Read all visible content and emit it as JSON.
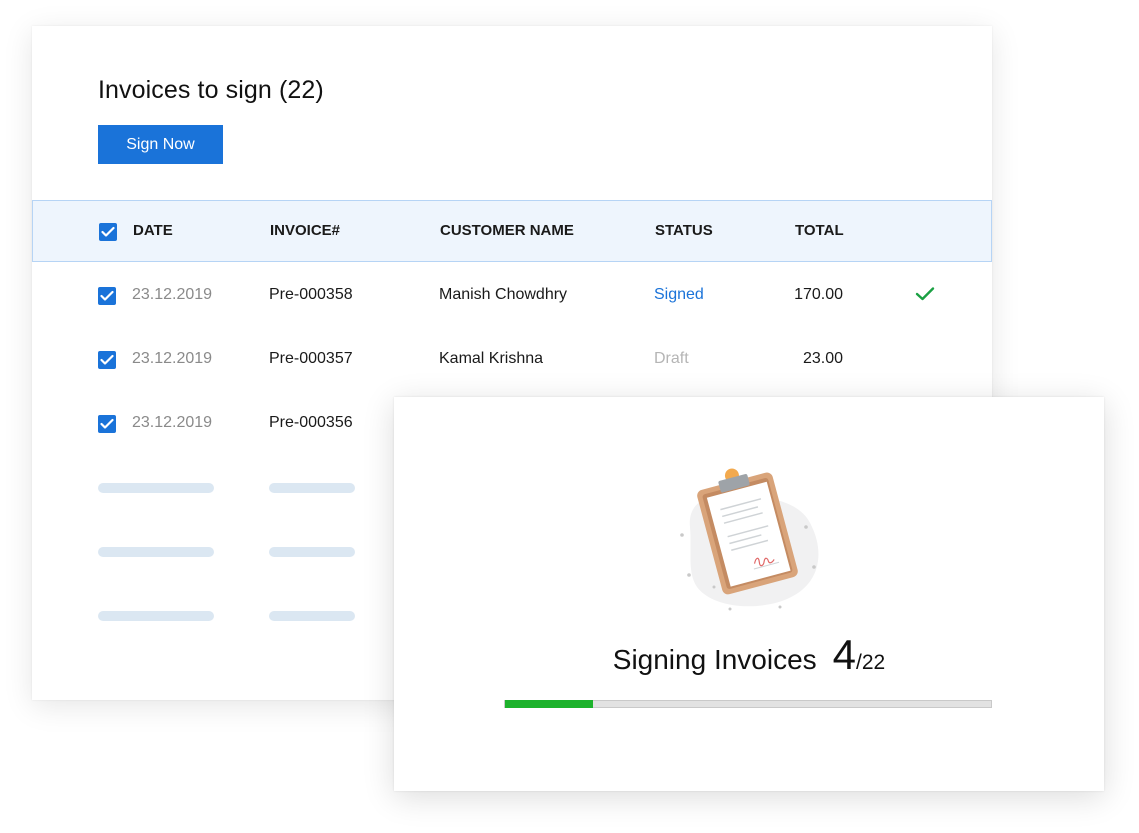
{
  "invoices": {
    "title": "Invoices to sign (22)",
    "sign_button_label": "Sign Now",
    "columns": {
      "date": "DATE",
      "invoice": "INVOICE#",
      "customer": "CUSTOMER NAME",
      "status": "STATUS",
      "total": "TOTAL"
    },
    "rows": [
      {
        "date": "23.12.2019",
        "invoice": "Pre-000358",
        "customer": "Manish Chowdhry",
        "status": "Signed",
        "total": "170.00",
        "checked": true,
        "signed": true
      },
      {
        "date": "23.12.2019",
        "invoice": "Pre-000357",
        "customer": "Kamal Krishna",
        "status": "Draft",
        "total": "23.00",
        "checked": true,
        "signed": false
      },
      {
        "date": "23.12.2019",
        "invoice": "Pre-000356",
        "customer": "",
        "status": "",
        "total": "",
        "checked": true,
        "signed": false
      }
    ]
  },
  "progress": {
    "label": "Signing Invoices",
    "current": "4",
    "total": "/22",
    "fraction": 0.1818
  },
  "colors": {
    "accent": "#1a73d9",
    "success": "#1db22c",
    "header_bg": "#eef5fd",
    "skeleton": "#dbe7f2"
  },
  "icons": {
    "header_checkbox": "checkbox-checked-icon",
    "row_checkbox": "checkbox-checked-icon",
    "signed_status": "checkmark-icon",
    "illustration": "clipboard-document-icon"
  }
}
